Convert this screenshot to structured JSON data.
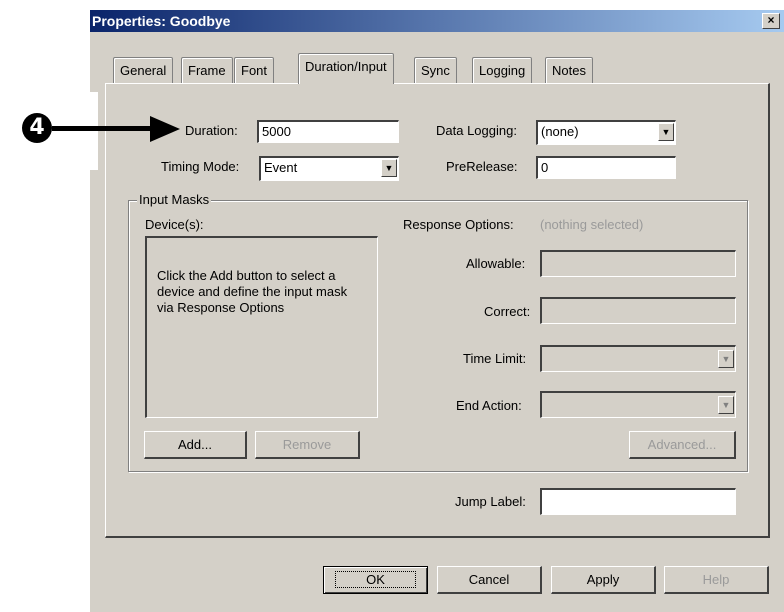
{
  "window": {
    "title": "Properties: Goodbye",
    "close_glyph": "×"
  },
  "tabs": [
    {
      "label": "General"
    },
    {
      "label": "Frame"
    },
    {
      "label": "Font"
    },
    {
      "label": "Duration/Input",
      "active": true
    },
    {
      "label": "Sync"
    },
    {
      "label": "Logging"
    },
    {
      "label": "Notes"
    }
  ],
  "callout": {
    "number": "4"
  },
  "fields": {
    "duration": {
      "label": "Duration:",
      "value": "5000"
    },
    "timing_mode": {
      "label": "Timing Mode:",
      "value": "Event"
    },
    "data_logging": {
      "label": "Data Logging:",
      "value": "(none)"
    },
    "prerelease": {
      "label": "PreRelease:",
      "value": "0"
    }
  },
  "input_masks": {
    "group_label": "Input Masks",
    "devices_label": "Device(s):",
    "devices_hint": "Click the Add button to select a device and define the input mask via Response Options",
    "response_options_label": "Response Options:",
    "response_options_status": "(nothing selected)",
    "allowable_label": "Allowable:",
    "correct_label": "Correct:",
    "time_limit_label": "Time Limit:",
    "end_action_label": "End Action:",
    "add_button": "Add...",
    "remove_button": "Remove",
    "advanced_button": "Advanced..."
  },
  "jump_label": {
    "label": "Jump Label:",
    "value": ""
  },
  "footer": {
    "ok": "OK",
    "cancel": "Cancel",
    "apply": "Apply",
    "help": "Help"
  },
  "icons": {
    "dropdown": "dropdown-arrow-icon",
    "callout": "callout-number-4"
  }
}
